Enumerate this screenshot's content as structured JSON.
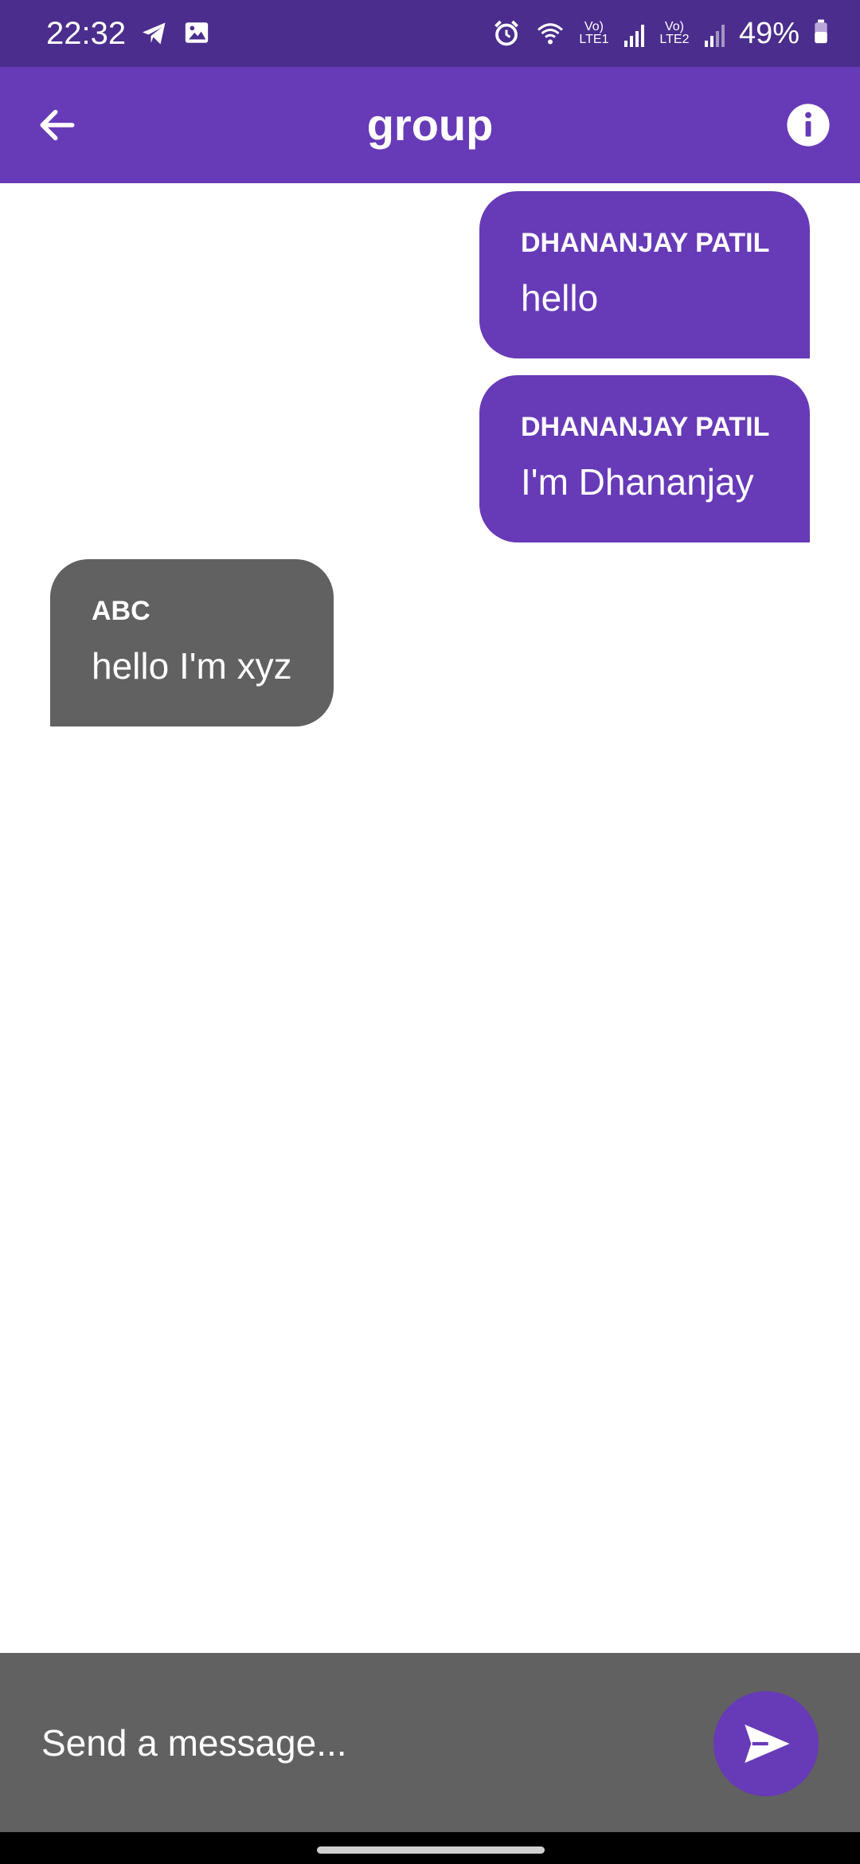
{
  "status_bar": {
    "time": "22:32",
    "battery": "49%",
    "sim1": "Vo) LTE1",
    "sim2": "Vo) LTE2",
    "icons": [
      "telegram-icon",
      "gallery-icon",
      "alarm-icon",
      "wifi-icon",
      "signal-icon",
      "battery-icon"
    ]
  },
  "app_bar": {
    "title": "group",
    "back_icon": "arrow-back-icon",
    "info_icon": "info-icon"
  },
  "messages": [
    {
      "sender": "DHANANJAY PATIL",
      "text": "hello",
      "is_me": true
    },
    {
      "sender": "DHANANJAY PATIL",
      "text": "I'm Dhananjay",
      "is_me": true
    },
    {
      "sender": "ABC",
      "text": "hello I'm xyz",
      "is_me": false
    }
  ],
  "composer": {
    "placeholder": "Send a message...",
    "value": "",
    "send_icon": "send-icon"
  },
  "colors": {
    "primary": "#673ab7",
    "status_bar": "#4a2d8c",
    "other_bubble": "#616161",
    "composer_bg": "#616161"
  }
}
